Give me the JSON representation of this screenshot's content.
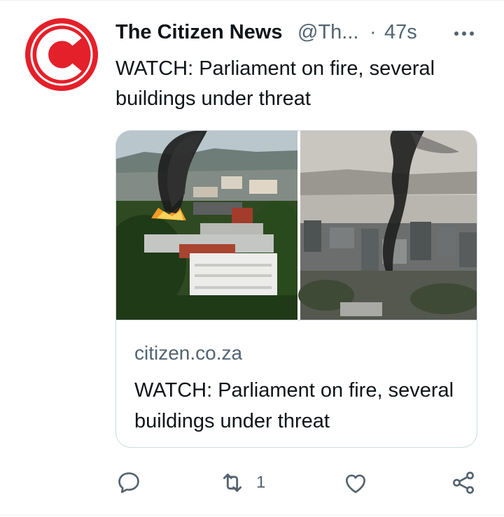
{
  "tweet": {
    "author_name": "The Citizen News",
    "handle": "@Th...",
    "separator": "·",
    "time": "47s",
    "text": "WATCH: Parliament on fire, several buildings under threat"
  },
  "card": {
    "domain": "citizen.co.za",
    "title": "WATCH: Parliament on fire, several buildings under threat"
  },
  "actions": {
    "reply_count": "",
    "retweet_count": "1",
    "like_count": ""
  },
  "colors": {
    "avatar_red": "#e4202a",
    "text_primary": "#0f1419",
    "text_secondary": "#536471",
    "border": "#cfd9de"
  },
  "icons": [
    "more-icon",
    "reply-icon",
    "retweet-icon",
    "like-icon",
    "share-icon"
  ]
}
